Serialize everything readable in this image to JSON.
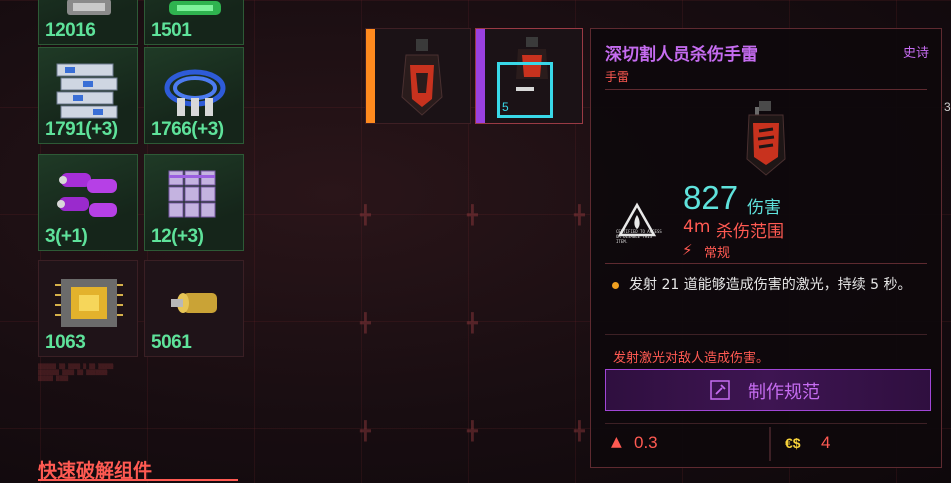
{
  "colors": {
    "quantity_green": "#5ee29a",
    "accent_red": "#ff5a52",
    "epic_purple": "#c56cf0",
    "damage_cyan": "#5fe2dc",
    "focus_cyan": "#39d8e8",
    "slot_orange": "#ff8a1e",
    "slot_purple": "#9a40e0",
    "money_yellow": "#f7d23a"
  },
  "inventory": {
    "items": [
      {
        "name": "component-top-left",
        "qty": "12016",
        "icon": "component-icon"
      },
      {
        "name": "component-top-right",
        "qty": "1501",
        "icon": "component-icon"
      },
      {
        "name": "circuit-boards",
        "qty": "1791(+3)",
        "icon": "circuit-board-icon"
      },
      {
        "name": "blue-cables",
        "qty": "1766(+3)",
        "icon": "cable-icon"
      },
      {
        "name": "purple-capacitors",
        "qty": "3(+1)",
        "icon": "capacitor-icon"
      },
      {
        "name": "purple-cells",
        "qty": "12(+3)",
        "icon": "cell-stack-icon"
      },
      {
        "name": "cpu-chip",
        "qty": "1063",
        "icon": "chip-icon"
      },
      {
        "name": "brass-cylinder",
        "qty": "5061",
        "icon": "cylinder-icon"
      }
    ],
    "section_title": "快速破解组件"
  },
  "selected": {
    "focused_count": "5"
  },
  "tooltip": {
    "title": "深切割人员杀伤手雷",
    "rarity": "史诗",
    "type": "手雷",
    "warning_text": "CERTIFIED TO ACCESS OR DISABLE THIS ITEM.",
    "damage_value": "827",
    "damage_label": "伤害",
    "range_value": "4m",
    "range_label": "杀伤范围",
    "mode_label": "常规",
    "effect": "发射 21 道能够造成伤害的激光，持续 5 秒。",
    "flavor": "发射激光对敌人造成伤害。",
    "craft_label": "制作规范",
    "weight": "0.3",
    "price_icon": "€$",
    "price": "4"
  },
  "edge": {
    "partial_number": "3"
  }
}
